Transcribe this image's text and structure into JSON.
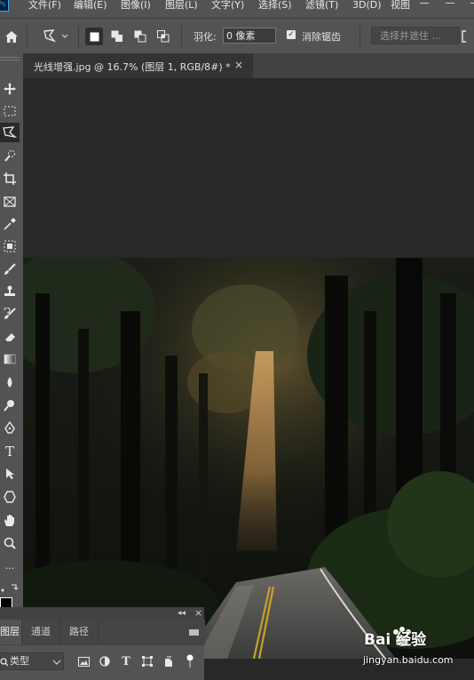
{
  "app": {
    "logo": "Ps"
  },
  "menubar": {
    "items": [
      {
        "label": "文件(F)"
      },
      {
        "label": "编辑(E)"
      },
      {
        "label": "图像(I)"
      },
      {
        "label": "图层(L)"
      },
      {
        "label": "文字(Y)"
      },
      {
        "label": "选择(S)"
      },
      {
        "label": "滤镜(T)"
      },
      {
        "label": "3D(D)"
      },
      {
        "label": "视图"
      }
    ]
  },
  "options": {
    "tool_icon": "polygonal-lasso-icon",
    "feather_label": "羽化:",
    "feather_value": "0 像素",
    "anti_alias_checked": true,
    "anti_alias_label": "消除锯齿",
    "select_mask_label": "选择并遮住 ..."
  },
  "document": {
    "tab_title": "光线增强.jpg @ 16.7% (图层 1, RGB/8#) *",
    "close_glyph": "×"
  },
  "toolbar": {
    "tools": [
      "move-tool-icon",
      "marquee-tool-icon",
      "lasso-tool-icon",
      "quick-selection-tool-icon",
      "crop-tool-icon",
      "frame-tool-icon",
      "eyedropper-tool-icon",
      "healing-brush-tool-icon",
      "brush-tool-icon",
      "clone-stamp-tool-icon",
      "history-brush-tool-icon",
      "eraser-tool-icon",
      "gradient-tool-icon",
      "blur-tool-icon",
      "dodge-tool-icon",
      "pen-tool-icon",
      "type-tool-icon",
      "path-selection-tool-icon",
      "shape-tool-icon",
      "hand-tool-icon",
      "zoom-tool-icon",
      "more-tools-icon"
    ],
    "type_glyph": "T",
    "more_glyph": "..."
  },
  "layers_panel": {
    "collapse_glyph": "◂◂",
    "close_glyph": "×",
    "tabs": [
      {
        "label": "图层"
      },
      {
        "label": "通道"
      },
      {
        "label": "路径"
      }
    ],
    "kind_label": "类型",
    "type_filter_glyph": "T"
  },
  "watermark": {
    "brand": "Bai 经验",
    "url": "jingyan.baidu.com"
  },
  "colors": {
    "panel": "#535353",
    "canvas_bg": "#282828",
    "accent": "#31a8ff"
  }
}
